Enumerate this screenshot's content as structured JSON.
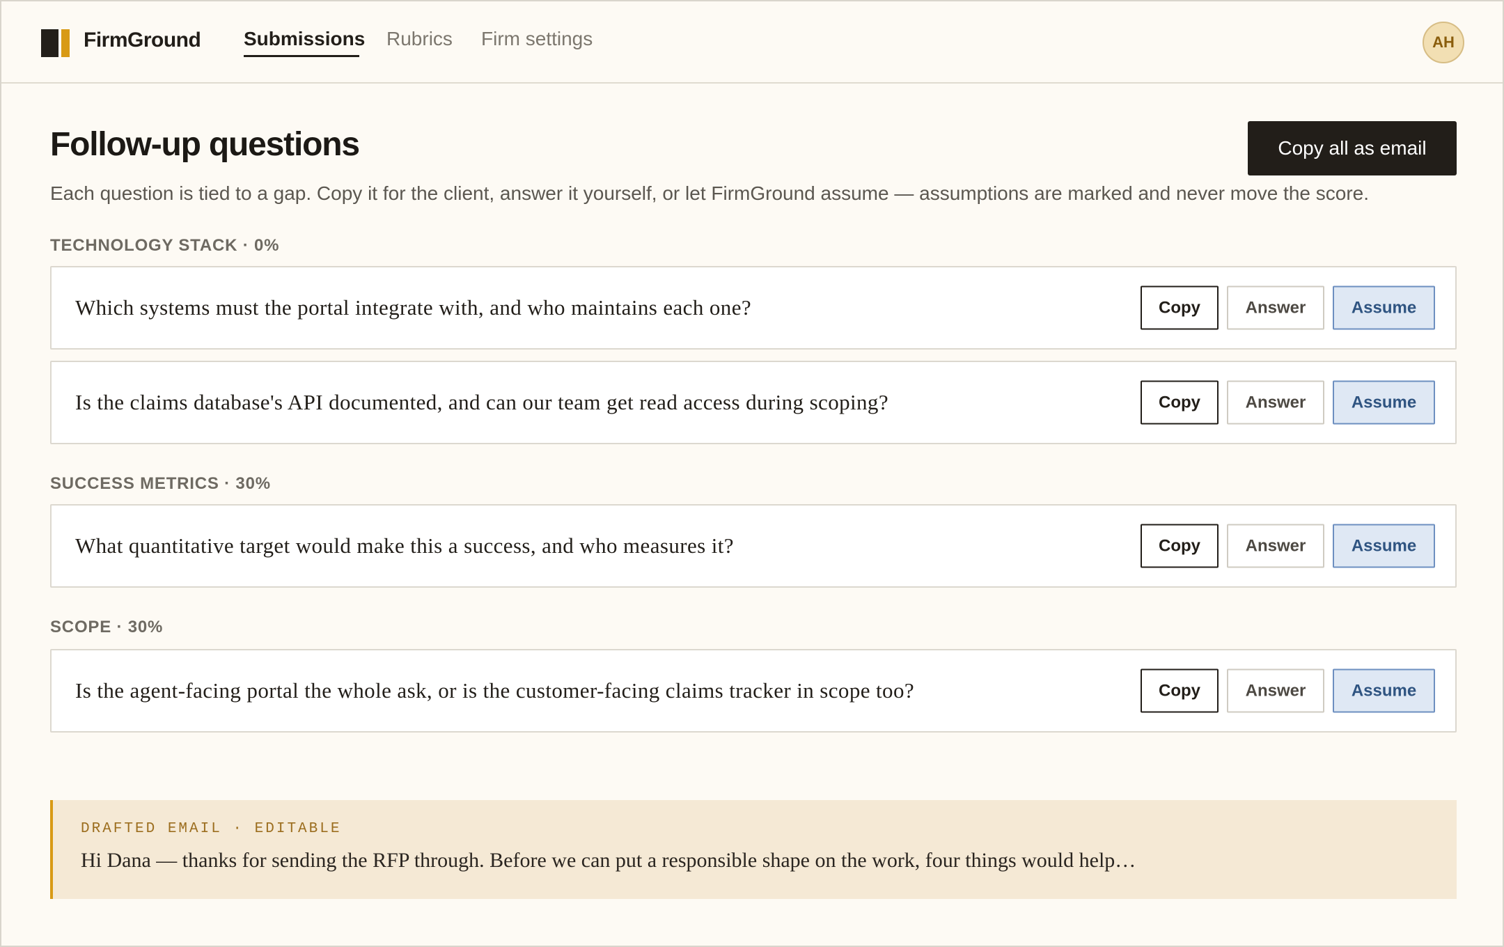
{
  "app": {
    "brand": "FirmGround",
    "nav": [
      {
        "label": "Submissions",
        "active": true
      },
      {
        "label": "Rubrics",
        "active": false
      },
      {
        "label": "Firm settings",
        "active": false
      }
    ],
    "user_initials": "AH"
  },
  "header": {
    "title": "Follow-up questions",
    "copy_all_label": "Copy all as email",
    "subtitle": "Each question is tied to a gap. Copy it for the client, answer it yourself, or let FirmGround assume — assumptions are marked and never move the score."
  },
  "actions": {
    "copy": "Copy",
    "answer": "Answer",
    "assume": "Assume"
  },
  "sections": [
    {
      "label": "TECHNOLOGY STACK · 0%",
      "questions": [
        "Which systems must the portal integrate with, and who maintains each one?",
        "Is the claims database's API documented, and can our team get read access during scoping?"
      ]
    },
    {
      "label": "SUCCESS METRICS · 30%",
      "questions": [
        "What quantitative target would make this a success, and who measures it?"
      ]
    },
    {
      "label": "SCOPE · 30%",
      "questions": [
        "Is the agent-facing portal the whole ask, or is the customer-facing claims tracker in scope too?"
      ]
    }
  ],
  "email": {
    "label": "DRAFTED EMAIL · EDITABLE",
    "body": "Hi Dana — thanks for sending the RFP through. Before we can put a responsible shape on the work, four things would help…"
  },
  "colors": {
    "background": "#fdfaf4",
    "ink": "#221e19",
    "accent": "#d89a15",
    "assume_fill": "#dfe8f4",
    "assume_border": "#6d8fc0",
    "email_bg": "#f5e9d5"
  }
}
